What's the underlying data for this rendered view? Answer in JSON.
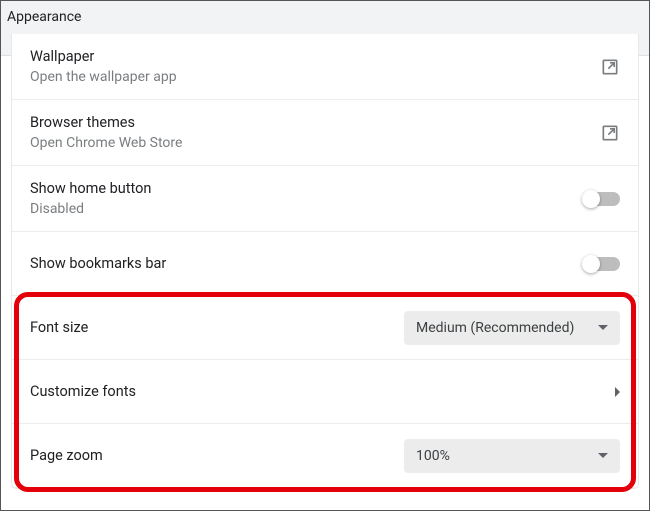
{
  "section": {
    "title": "Appearance"
  },
  "rows": {
    "wallpaper": {
      "title": "Wallpaper",
      "sub": "Open the wallpaper app"
    },
    "themes": {
      "title": "Browser themes",
      "sub": "Open Chrome Web Store"
    },
    "homebtn": {
      "title": "Show home button",
      "sub": "Disabled"
    },
    "bookmarks": {
      "title": "Show bookmarks bar"
    },
    "fontsize": {
      "title": "Font size",
      "value": "Medium (Recommended)"
    },
    "custfonts": {
      "title": "Customize fonts"
    },
    "pagezoom": {
      "title": "Page zoom",
      "value": "100%"
    }
  }
}
